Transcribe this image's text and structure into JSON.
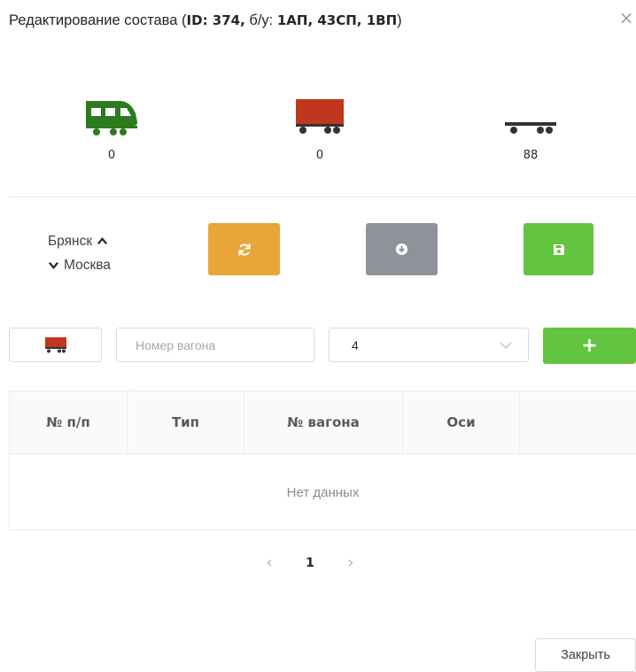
{
  "header": {
    "title_prefix": "Редактирование состава (",
    "id_label": "ID: 374,",
    "bu_label": " б/у: ",
    "bu_values": "1АП, 43СП, 1ВП",
    "title_suffix": ")",
    "close_glyph": "×"
  },
  "stock": [
    {
      "name": "locomotive",
      "count": "0",
      "color": "#2d7a1f"
    },
    {
      "name": "freight-car",
      "count": "0",
      "color": "#c0371e"
    },
    {
      "name": "flatcar",
      "count": "88",
      "color": "#333333"
    }
  ],
  "route": {
    "from": "Брянск",
    "to": "Москва"
  },
  "actions": {
    "refresh_icon": "refresh-icon",
    "download_icon": "download-icon",
    "save_icon": "save-icon",
    "colors": {
      "refresh": "#e8a53a",
      "download": "#8d9399",
      "save": "#63c440"
    }
  },
  "add_form": {
    "wagon_placeholder": "Номер вагона",
    "axles_value": "4",
    "add_label": "+"
  },
  "table": {
    "columns": [
      "№ п/п",
      "Тип",
      "№ вагона",
      "Оси",
      ""
    ],
    "empty_text": "Нет данных"
  },
  "pagination": {
    "prev": "‹",
    "current": "1",
    "next": "›"
  },
  "footer": {
    "close_label": "Закрыть"
  }
}
